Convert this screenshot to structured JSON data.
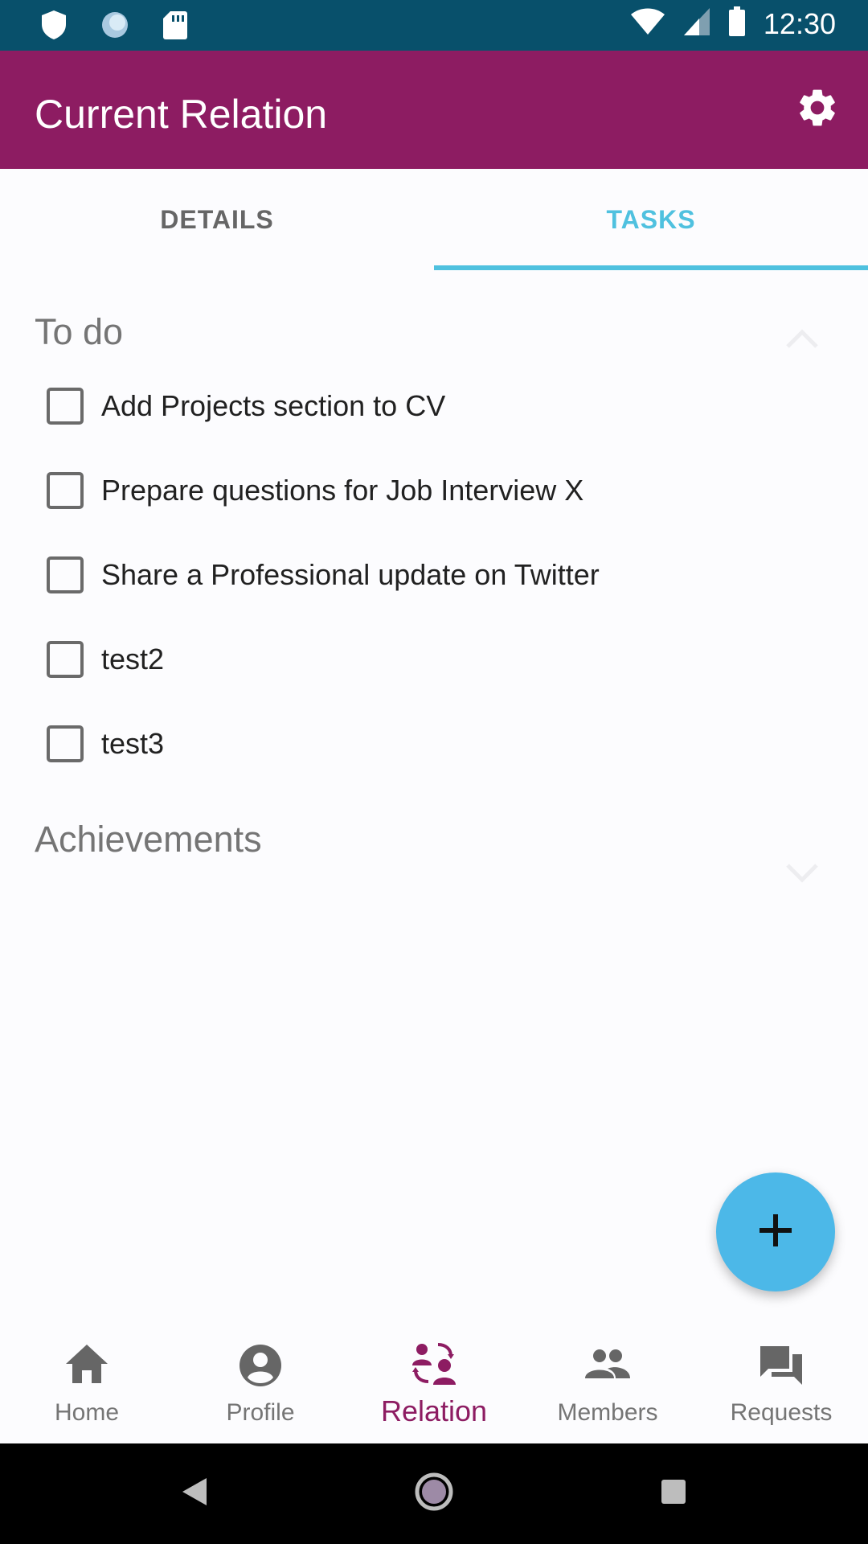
{
  "status_bar": {
    "time": "12:30",
    "icons": [
      "shield-icon",
      "circle-icon",
      "sd-card-icon",
      "wifi-icon",
      "signal-icon",
      "battery-icon"
    ]
  },
  "app_bar": {
    "title": "Current Relation",
    "settings_icon": "gear-icon"
  },
  "tabs": [
    {
      "label": "DETAILS",
      "active": false
    },
    {
      "label": "TASKS",
      "active": true
    }
  ],
  "sections": {
    "todo": {
      "title": "To do",
      "expanded": true,
      "items": [
        {
          "label": "Add Projects section to CV",
          "checked": false
        },
        {
          "label": "Prepare questions for Job Interview X",
          "checked": false
        },
        {
          "label": "Share a Professional update on Twitter",
          "checked": false
        },
        {
          "label": "test2",
          "checked": false
        },
        {
          "label": "test3",
          "checked": false
        }
      ]
    },
    "achievements": {
      "title": "Achievements",
      "expanded": false
    }
  },
  "fab": {
    "icon": "plus-icon"
  },
  "bottom_nav": [
    {
      "label": "Home",
      "icon": "home-icon",
      "active": false
    },
    {
      "label": "Profile",
      "icon": "account-circle-icon",
      "active": false
    },
    {
      "label": "Relation",
      "icon": "relation-icon",
      "active": true
    },
    {
      "label": "Members",
      "icon": "group-icon",
      "active": false
    },
    {
      "label": "Requests",
      "icon": "forum-icon",
      "active": false
    }
  ],
  "colors": {
    "status_bar": "#08506b",
    "app_bar": "#8d1c62",
    "accent": "#4fc1df",
    "fab": "#4cb8e8",
    "active_nav": "#8d1c62"
  }
}
